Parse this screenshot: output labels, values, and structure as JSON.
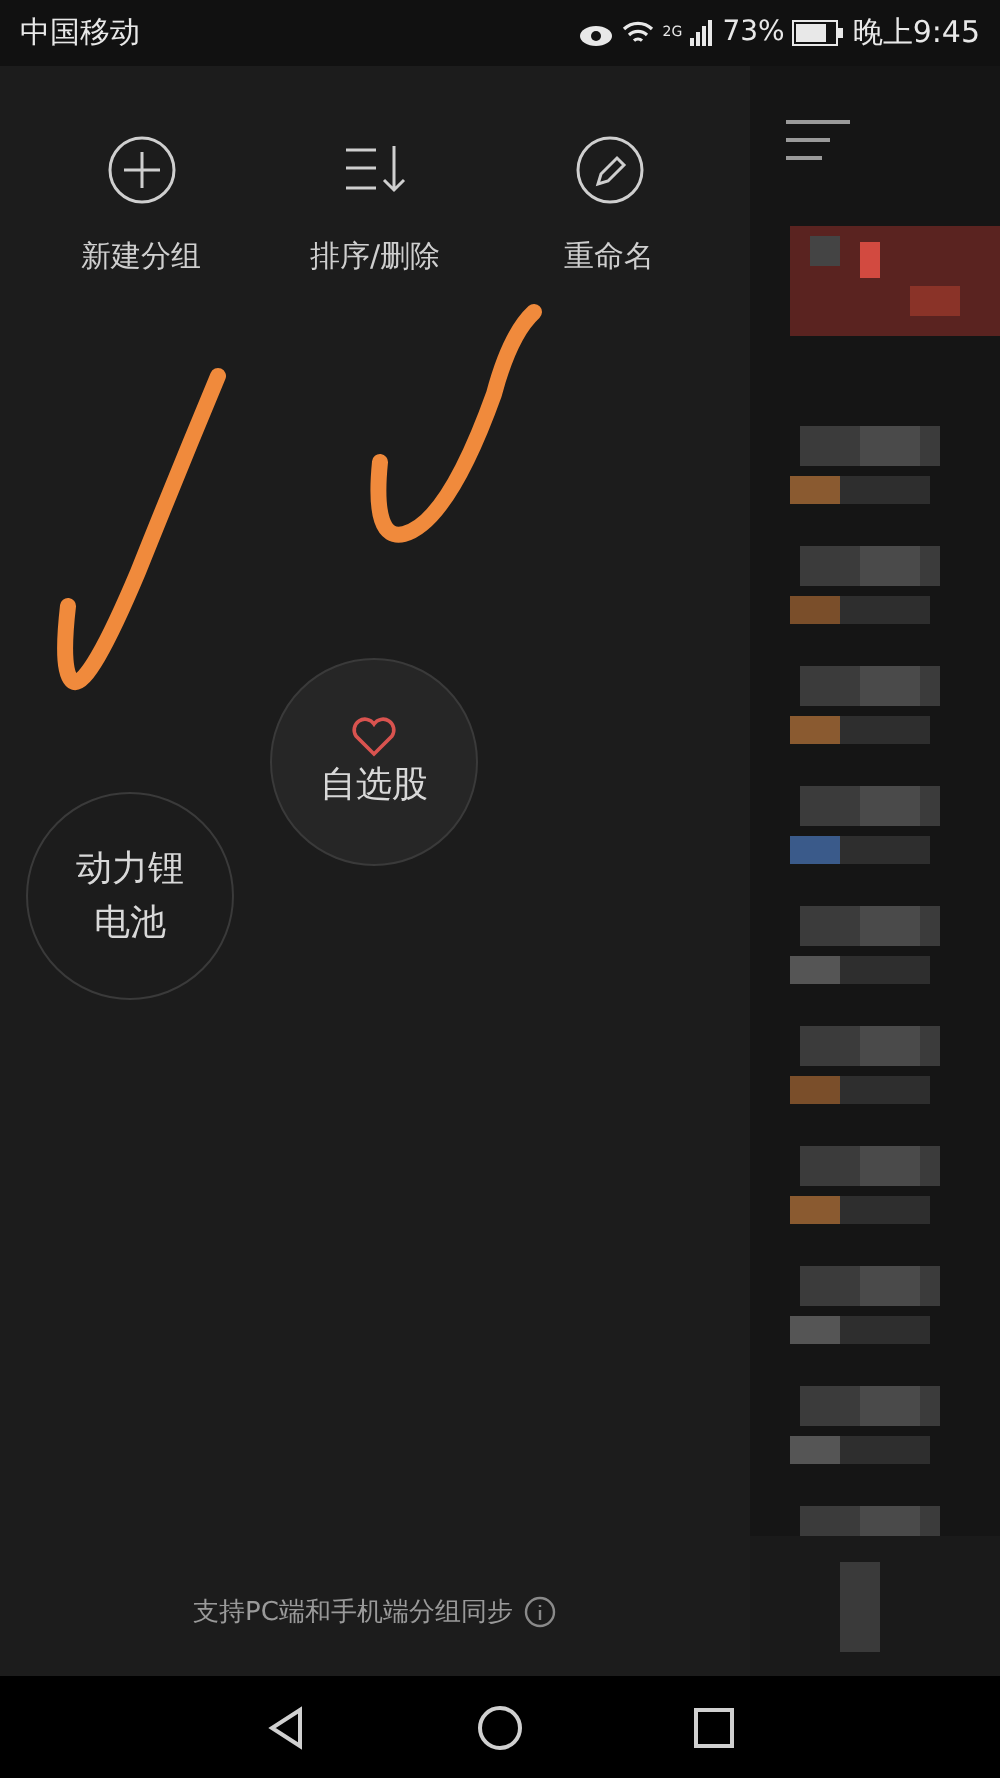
{
  "status_bar": {
    "carrier": "中国移动",
    "network": "2G",
    "battery": "73%",
    "time": "晚上9:45"
  },
  "actions": [
    {
      "label": "新建分组",
      "kind": "add"
    },
    {
      "label": "排序/删除",
      "kind": "sort"
    },
    {
      "label": "重命名",
      "kind": "rename"
    }
  ],
  "groups": [
    {
      "label": "自选股",
      "kind": "favorite"
    },
    {
      "label": "动力锂电池",
      "kind": "custom"
    }
  ],
  "footer_note": "支持PC端和手机端分组同步"
}
